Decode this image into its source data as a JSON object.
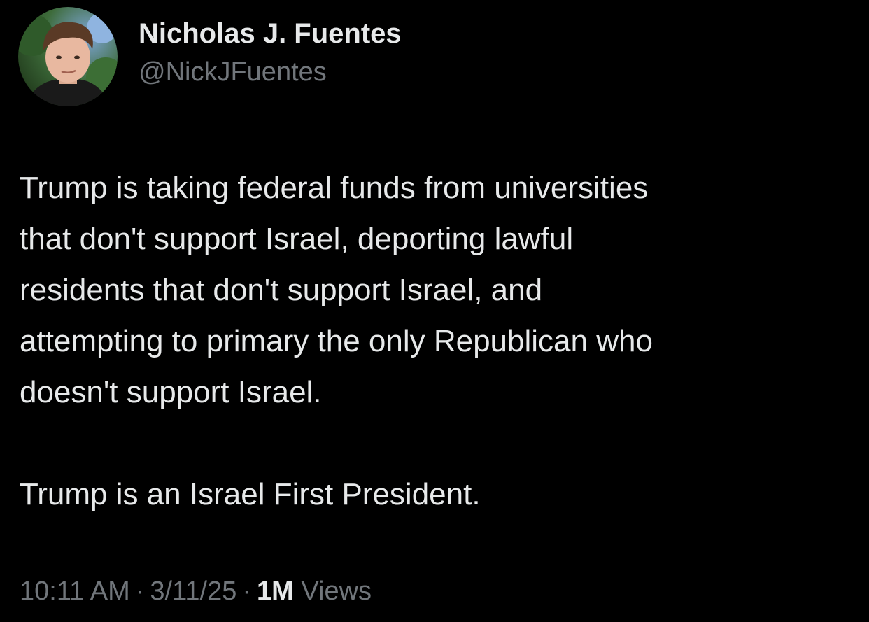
{
  "author": {
    "display_name": "Nicholas J. Fuentes",
    "handle": "@NickJFuentes",
    "avatar_icon": "profile-photo"
  },
  "tweet": {
    "paragraphs": [
      "Trump is taking federal funds from universities\nthat don't support Israel, deporting lawful\nresidents that don't support Israel, and\nattempting to primary the only Republican who\ndoesn't support Israel.",
      "Trump is an Israel First President."
    ]
  },
  "meta": {
    "time": "10:11 AM",
    "separator": "·",
    "date": "3/11/25",
    "views_count": "1M",
    "views_label": "Views"
  },
  "colors": {
    "background": "#000000",
    "primary_text": "#e7e9ea",
    "secondary_text": "#71767b"
  }
}
